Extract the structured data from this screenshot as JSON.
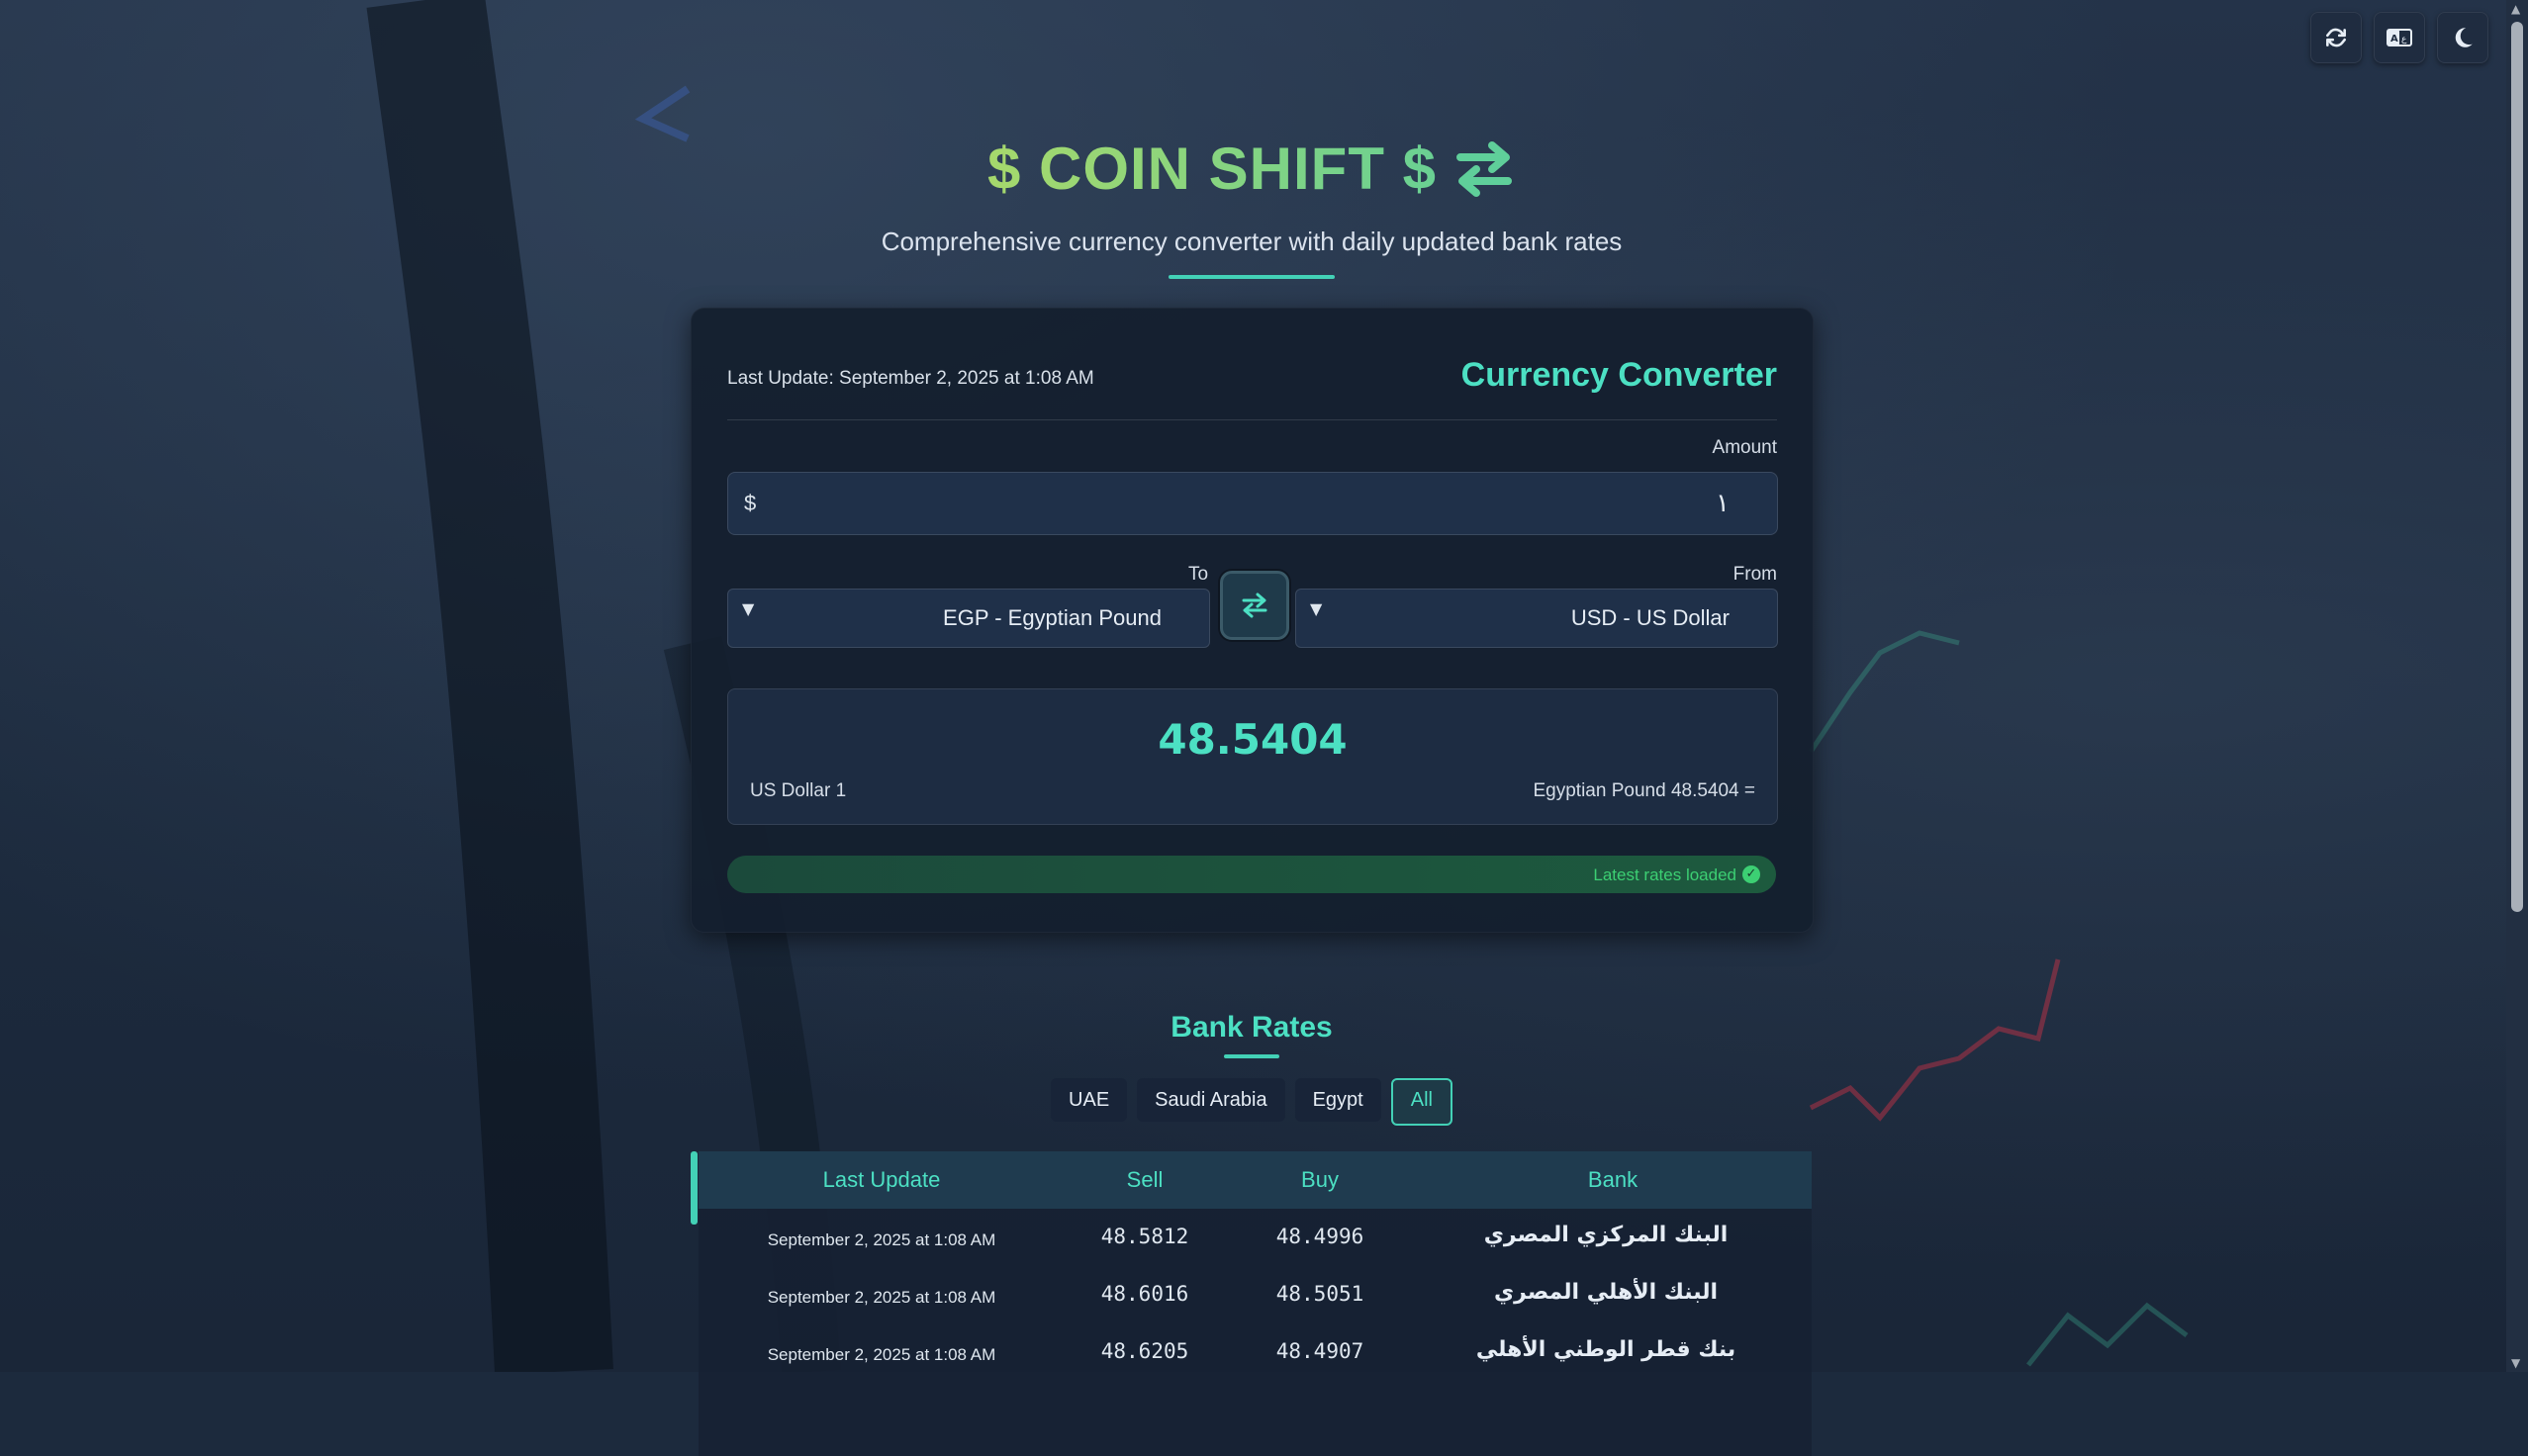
{
  "header": {
    "brand_text": "$ COIN SHIFT $",
    "subtitle": "Comprehensive currency converter with daily updated bank rates"
  },
  "top_actions": {
    "refresh_icon": "refresh-icon",
    "language_icon": "language-icon",
    "theme_icon": "moon-icon"
  },
  "converter": {
    "last_update": "Last Update: September 2, 2025 at 1:08 AM",
    "title": "Currency Converter",
    "amount_label": "Amount",
    "amount_symbol": "$",
    "amount_value": "١",
    "to_label": "To",
    "from_label": "From",
    "to_value": "EGP - Egyptian Pound",
    "from_value": "USD - US Dollar",
    "result_value": "48.5404",
    "result_left": "US Dollar 1",
    "result_right": "Egyptian Pound 48.5404 =",
    "status_text": "Latest rates loaded",
    "status_color": "#3ccf73",
    "accent_color": "#4ce0c3"
  },
  "bank_rates": {
    "title": "Bank Rates",
    "filters": [
      "UAE",
      "Saudi Arabia",
      "Egypt",
      "All"
    ],
    "active_filter": "All",
    "columns": [
      "Last Update",
      "Sell",
      "Buy",
      "Bank"
    ],
    "rows": [
      {
        "last_update": "September 2, 2025 at 1:08 AM",
        "sell": "48.5812",
        "buy": "48.4996",
        "bank": "البنك المركزي المصري"
      },
      {
        "last_update": "September 2, 2025 at 1:08 AM",
        "sell": "48.6016",
        "buy": "48.5051",
        "bank": "البنك الأهلي المصري"
      },
      {
        "last_update": "September 2, 2025 at 1:08 AM",
        "sell": "48.6205",
        "buy": "48.4907",
        "bank": "بنك قطر الوطني الأهلي"
      }
    ]
  }
}
